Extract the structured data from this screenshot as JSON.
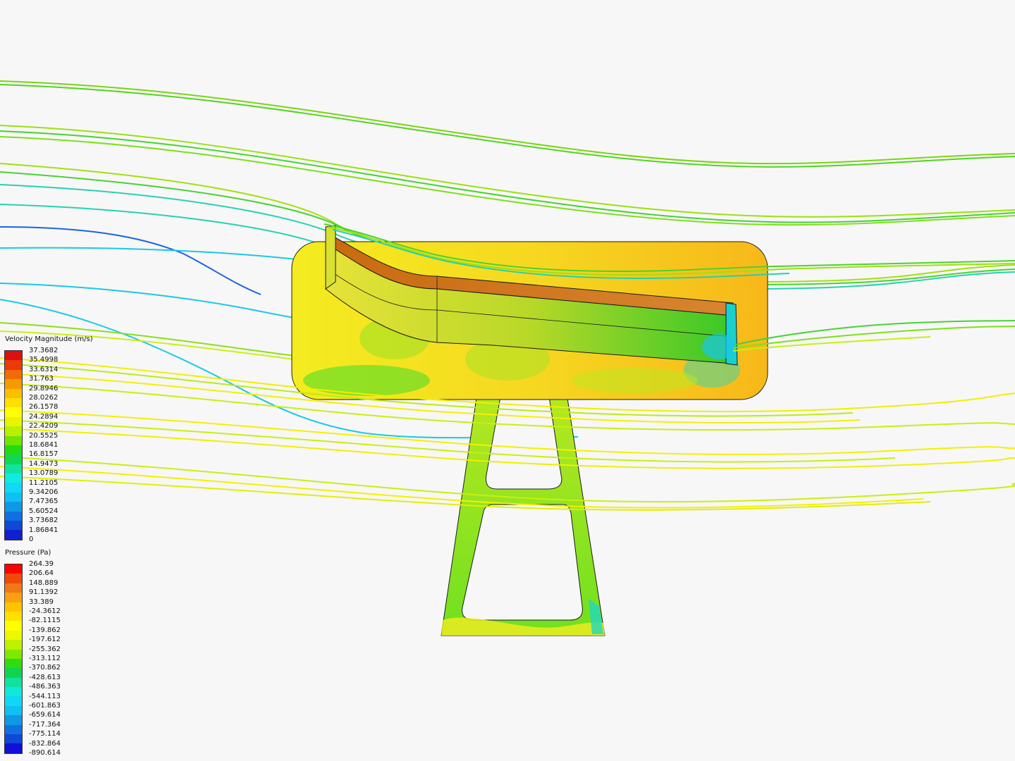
{
  "velocity_legend": {
    "title": "Velocity Magnitude (m/s)",
    "labels": [
      "37.3682",
      "35.4998",
      "33.6314",
      "31.763",
      "29.8946",
      "28.0262",
      "26.1578",
      "24.2894",
      "22.4209",
      "20.5525",
      "18.6841",
      "16.8157",
      "14.9473",
      "13.0789",
      "11.2105",
      "9.34206",
      "7.47365",
      "5.60524",
      "3.73682",
      "1.86841",
      "0"
    ],
    "colors": [
      "#dc1010",
      "#e83a0a",
      "#f06a05",
      "#f59a00",
      "#fac000",
      "#fde000",
      "#ffff00",
      "#e8f500",
      "#b8f000",
      "#6fe600",
      "#20dc10",
      "#10d850",
      "#10e4a0",
      "#10eae0",
      "#10d8f5",
      "#10c0f0",
      "#1098e8",
      "#1070e0",
      "#1048d8",
      "#1020d0"
    ]
  },
  "pressure_legend": {
    "title": "Pressure (Pa)",
    "labels": [
      "264.39",
      "206.64",
      "148.889",
      "91.1392",
      "33.389",
      "-24.3612",
      "-82.1115",
      "-139.862",
      "-197.612",
      "-255.362",
      "-313.112",
      "-370.862",
      "-428.613",
      "-486.363",
      "-544.113",
      "-601.863",
      "-659.614",
      "-717.364",
      "-775.114",
      "-832.864",
      "-890.614"
    ],
    "colors": [
      "#ff0000",
      "#f04a08",
      "#f07818",
      "#fba010",
      "#ffc400",
      "#ffe000",
      "#ffff00",
      "#ecf800",
      "#c0f000",
      "#80e800",
      "#30dc10",
      "#10d450",
      "#10e0a0",
      "#10e8d8",
      "#10d8f2",
      "#10c0f0",
      "#1098e8",
      "#1070e0",
      "#1048d8",
      "#1010d8"
    ]
  },
  "colors": {
    "background": "#f7f7f7",
    "wing_high_pressure": "#e07a1a",
    "plate_base": "#f6ea22",
    "stand_base": "#a8e82a"
  }
}
